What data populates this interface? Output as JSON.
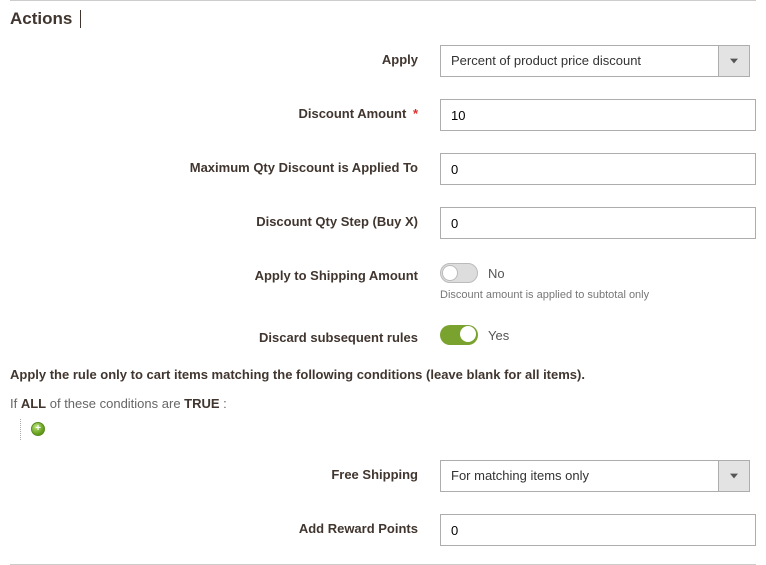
{
  "section_title": "Actions",
  "labels": {
    "apply": "Apply",
    "discount_amount": "Discount Amount",
    "max_qty": "Maximum Qty Discount is Applied To",
    "qty_step": "Discount Qty Step (Buy X)",
    "apply_shipping": "Apply to Shipping Amount",
    "discard": "Discard subsequent rules",
    "free_shipping": "Free Shipping",
    "reward_points": "Add Reward Points"
  },
  "values": {
    "apply": "Percent of product price discount",
    "discount_amount": "10",
    "max_qty": "0",
    "qty_step": "0",
    "apply_shipping_state": "No",
    "discard_state": "Yes",
    "free_shipping": "For matching items only",
    "reward_points": "0"
  },
  "hints": {
    "apply_shipping": "Discount amount is applied to subtotal only"
  },
  "conditions": {
    "intro": "Apply the rule only to cart items matching the following conditions (leave blank for all items).",
    "prefix": "If ",
    "all": "ALL",
    "mid": "  of these conditions are ",
    "true": "TRUE",
    "suffix": " :"
  },
  "required_marker": "*"
}
